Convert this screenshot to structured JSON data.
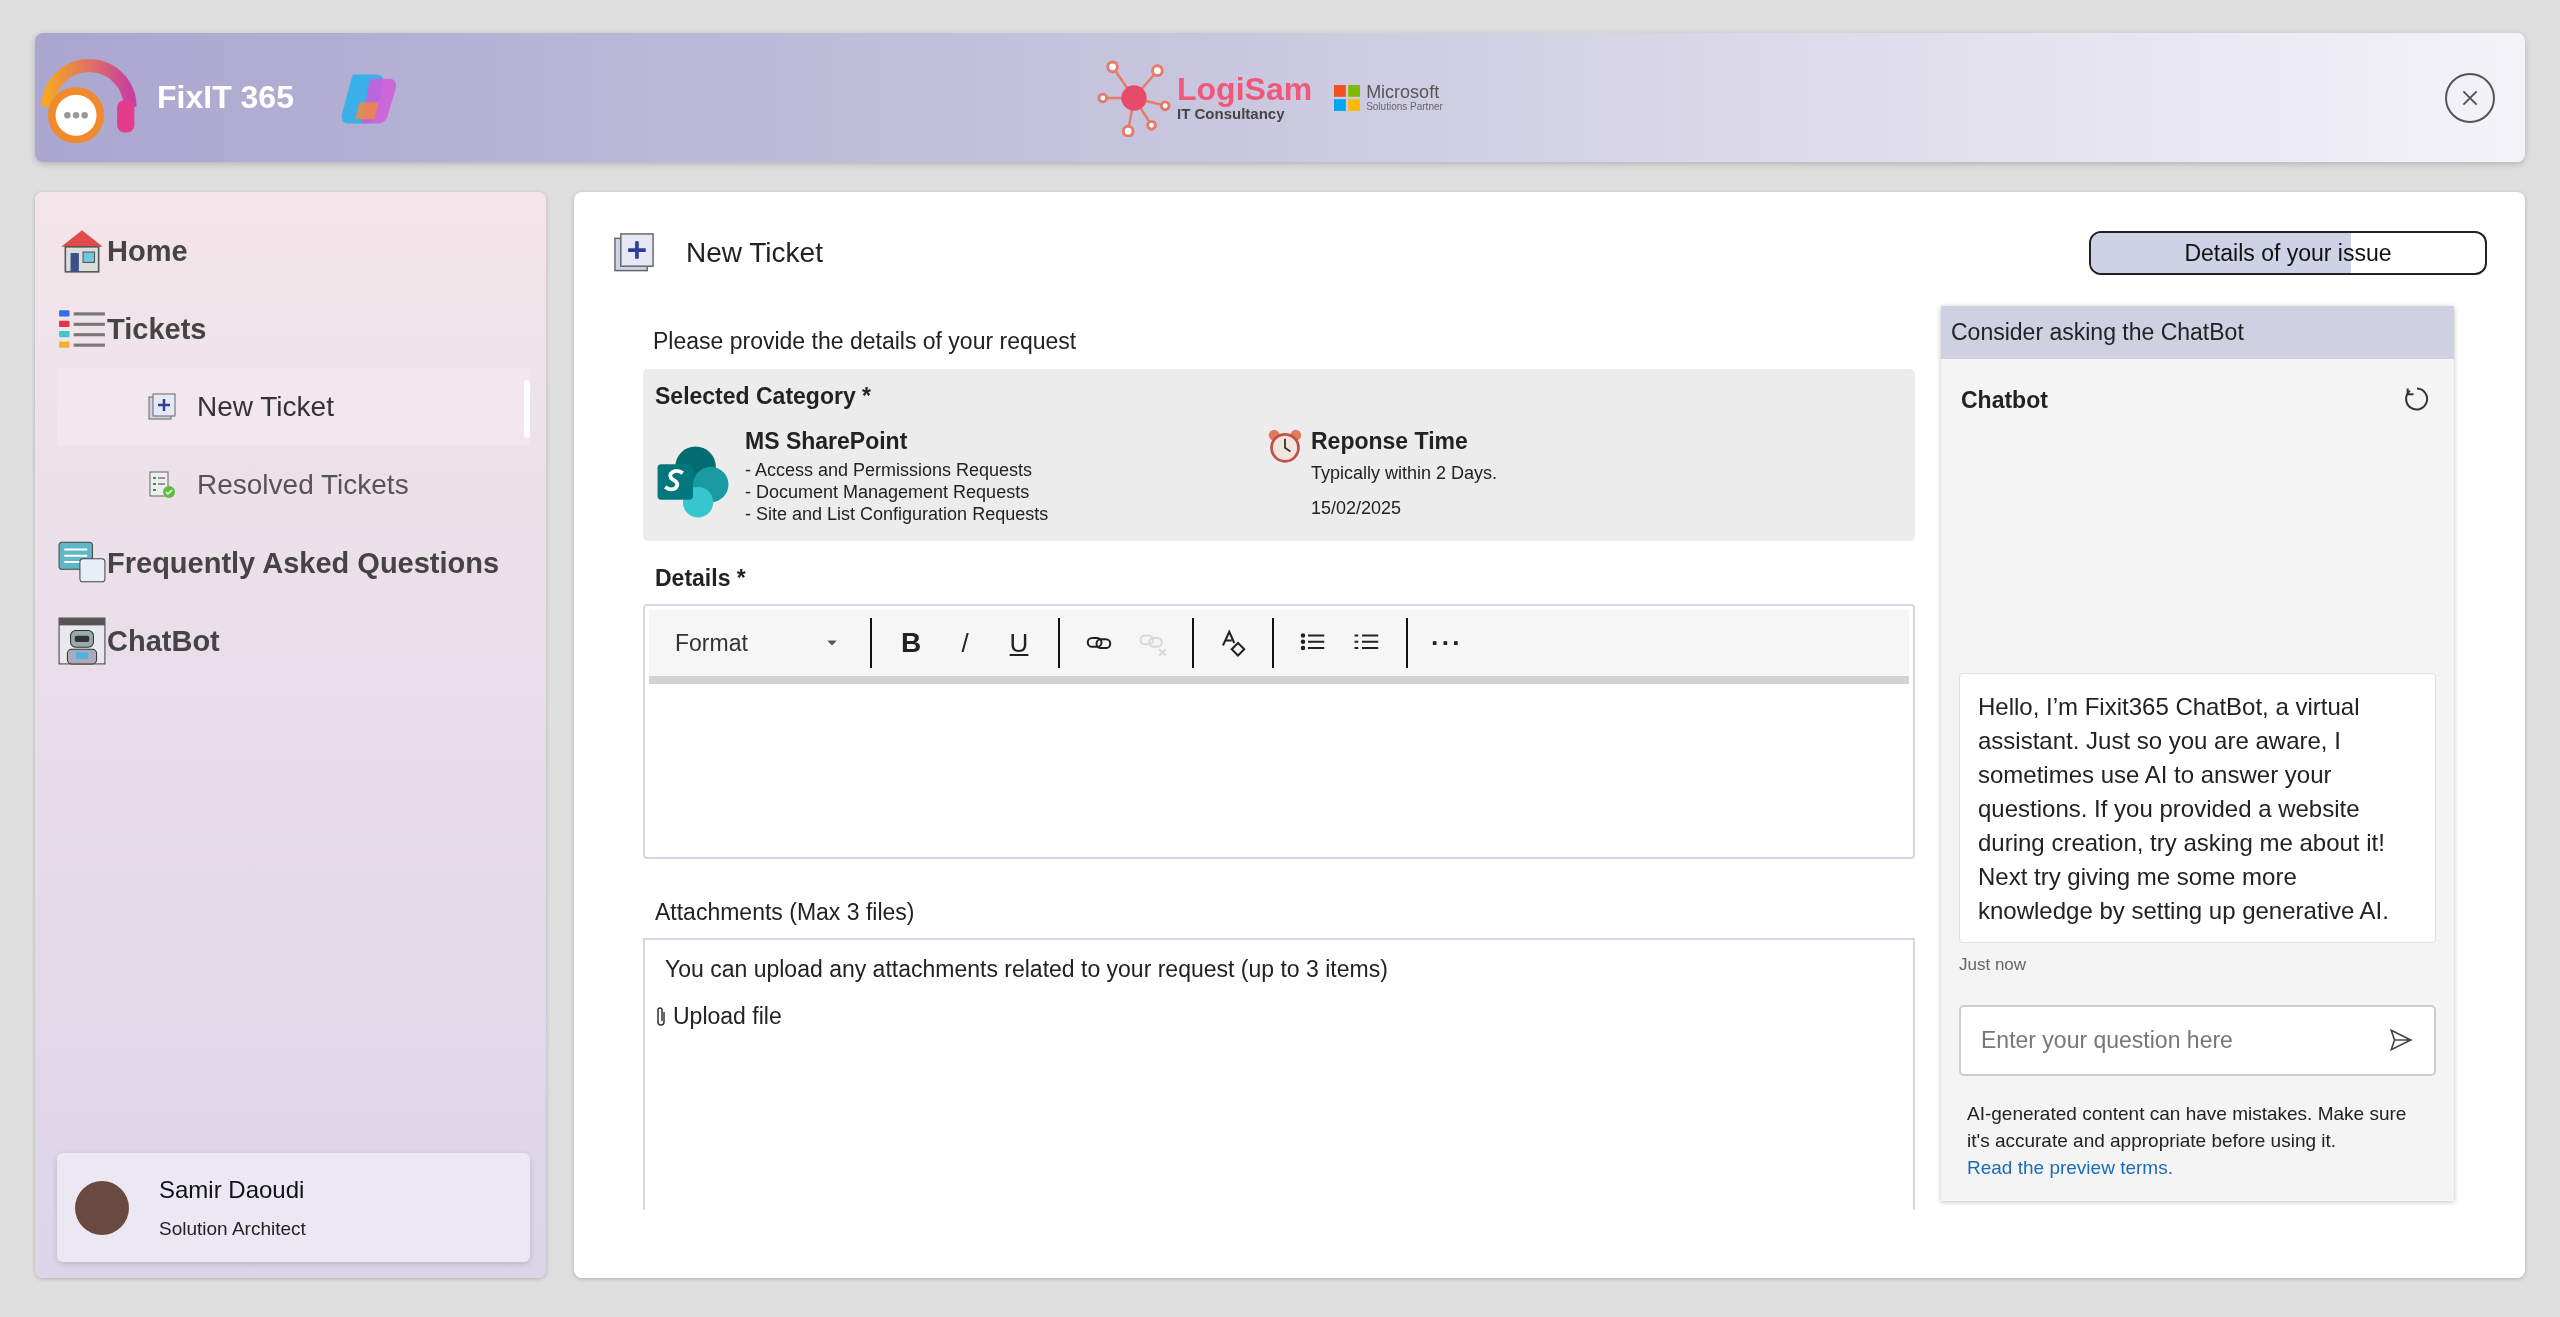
{
  "header": {
    "app_name": "FixIT 365",
    "partner_logo": {
      "name": "LogiSam",
      "tagline": "IT Consultancy"
    },
    "ms_badge": {
      "name": "Microsoft",
      "tagline": "Solutions Partner"
    }
  },
  "sidebar": {
    "items": [
      {
        "label": "Home",
        "kind": "home"
      },
      {
        "label": "Tickets",
        "kind": "tickets",
        "children": [
          {
            "label": "New Ticket",
            "kind": "new",
            "selected": true
          },
          {
            "label": "Resolved Tickets",
            "kind": "resolved",
            "selected": false
          }
        ]
      },
      {
        "label": "Frequently Asked Questions",
        "kind": "faq"
      },
      {
        "label": "ChatBot",
        "kind": "bot"
      }
    ],
    "user": {
      "name": "Samir Daoudi",
      "role": "Solution Architect"
    }
  },
  "page": {
    "title": "New Ticket",
    "progress": {
      "label": "Details of your issue",
      "level": 0.66
    }
  },
  "form": {
    "intro": "Please provide the details of your request",
    "category": {
      "heading": "Selected Category *",
      "name": "MS SharePoint",
      "items": [
        "- Access and Permissions Requests",
        "- Document Management Requests",
        "- Site and List Configuration Requests"
      ],
      "response_heading": "Reponse Time",
      "response_text": "Typically within 2 Days.",
      "date": "15/02/2025"
    },
    "details_label": "Details *",
    "toolbar": [
      {
        "kind": "format",
        "label": "Format",
        "disabled": false
      },
      {
        "kind": "sep"
      },
      {
        "kind": "bold",
        "label": "B",
        "disabled": false
      },
      {
        "kind": "italic",
        "label": "/",
        "disabled": false
      },
      {
        "kind": "underline",
        "label": "U",
        "disabled": false
      },
      {
        "kind": "sep"
      },
      {
        "kind": "link",
        "disabled": false
      },
      {
        "kind": "unlink",
        "disabled": true
      },
      {
        "kind": "sep"
      },
      {
        "kind": "clear",
        "disabled": false
      },
      {
        "kind": "sep"
      },
      {
        "kind": "bullets",
        "disabled": false
      },
      {
        "kind": "numbers",
        "disabled": false
      },
      {
        "kind": "sep"
      },
      {
        "kind": "more",
        "label": "···",
        "disabled": false
      }
    ],
    "attachments_label": "Attachments (Max 3 files)",
    "attachments_hint": "You can upload any attachments related to your request (up to 3 items)",
    "upload": "Upload file"
  },
  "chat": {
    "banner": "Consider asking the ChatBot",
    "title": "Chatbot",
    "message": "Hello, I’m Fixit365 ChatBot, a virtual assistant. Just so you are aware, I sometimes use AI to answer your questions. If you provided a website during creation, try asking me about it! Next try giving me some more knowledge by setting up generative AI.",
    "time": "Just now",
    "placeholder": "Enter your question here",
    "disclaimer": "AI-generated content can have mistakes. Make sure it's accurate and appropriate before using it.",
    "link": "Read the preview terms."
  }
}
